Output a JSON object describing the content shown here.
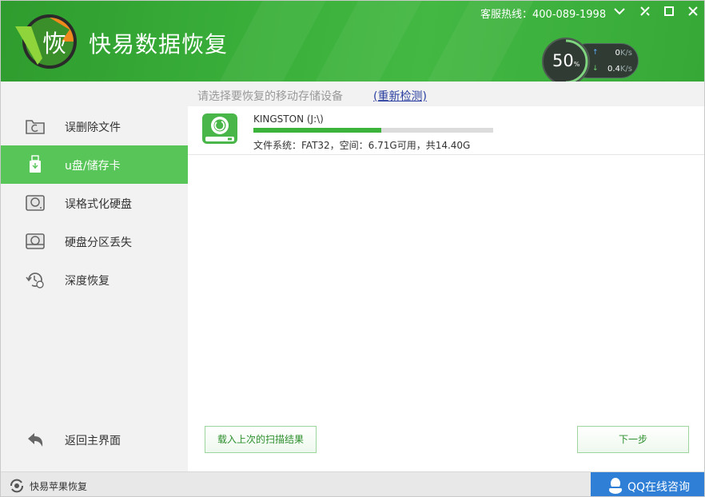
{
  "app": {
    "title": "快易数据恢复",
    "logo_char": "恢",
    "hotline": "客服热线：400-089-1998"
  },
  "window_controls": [
    "chevron-down-icon",
    "settings-icon",
    "maximize-icon",
    "close-icon"
  ],
  "speed_widget": {
    "percent": "50",
    "percent_unit": "%",
    "upload_value": "0",
    "upload_unit": "K/s",
    "download_value": "0.4",
    "download_unit": "K/s"
  },
  "sidebar": {
    "items": [
      {
        "label": "误删除文件",
        "icon": "folder-recover-icon",
        "active": false
      },
      {
        "label": "u盘/储存卡",
        "icon": "usb-drive-icon",
        "active": true
      },
      {
        "label": "误格式化硬盘",
        "icon": "format-disk-icon",
        "active": false
      },
      {
        "label": "硬盘分区丢失",
        "icon": "partition-icon",
        "active": false
      },
      {
        "label": "深度恢复",
        "icon": "deep-recover-icon",
        "active": false
      }
    ],
    "back_label": "返回主界面"
  },
  "main": {
    "prompt": "请选择要恢复的移动存储设备",
    "rescan_label": "(重新检测)",
    "device": {
      "name": "KINGSTON (J:\\)",
      "info": "文件系统：FAT32，空间：6.71G可用，共14.40G",
      "used_fraction": 0.534
    },
    "load_last_label": "载入上次的扫描结果",
    "next_label": "下一步"
  },
  "footer": {
    "apple_recover_label": "快易苹果恢复",
    "qq_label": "QQ在线咨询"
  },
  "colors": {
    "header_green": "#3bb13b",
    "active_green": "#58c558",
    "bar_green": "#3cb43c",
    "qq_blue": "#2f7fd6"
  }
}
